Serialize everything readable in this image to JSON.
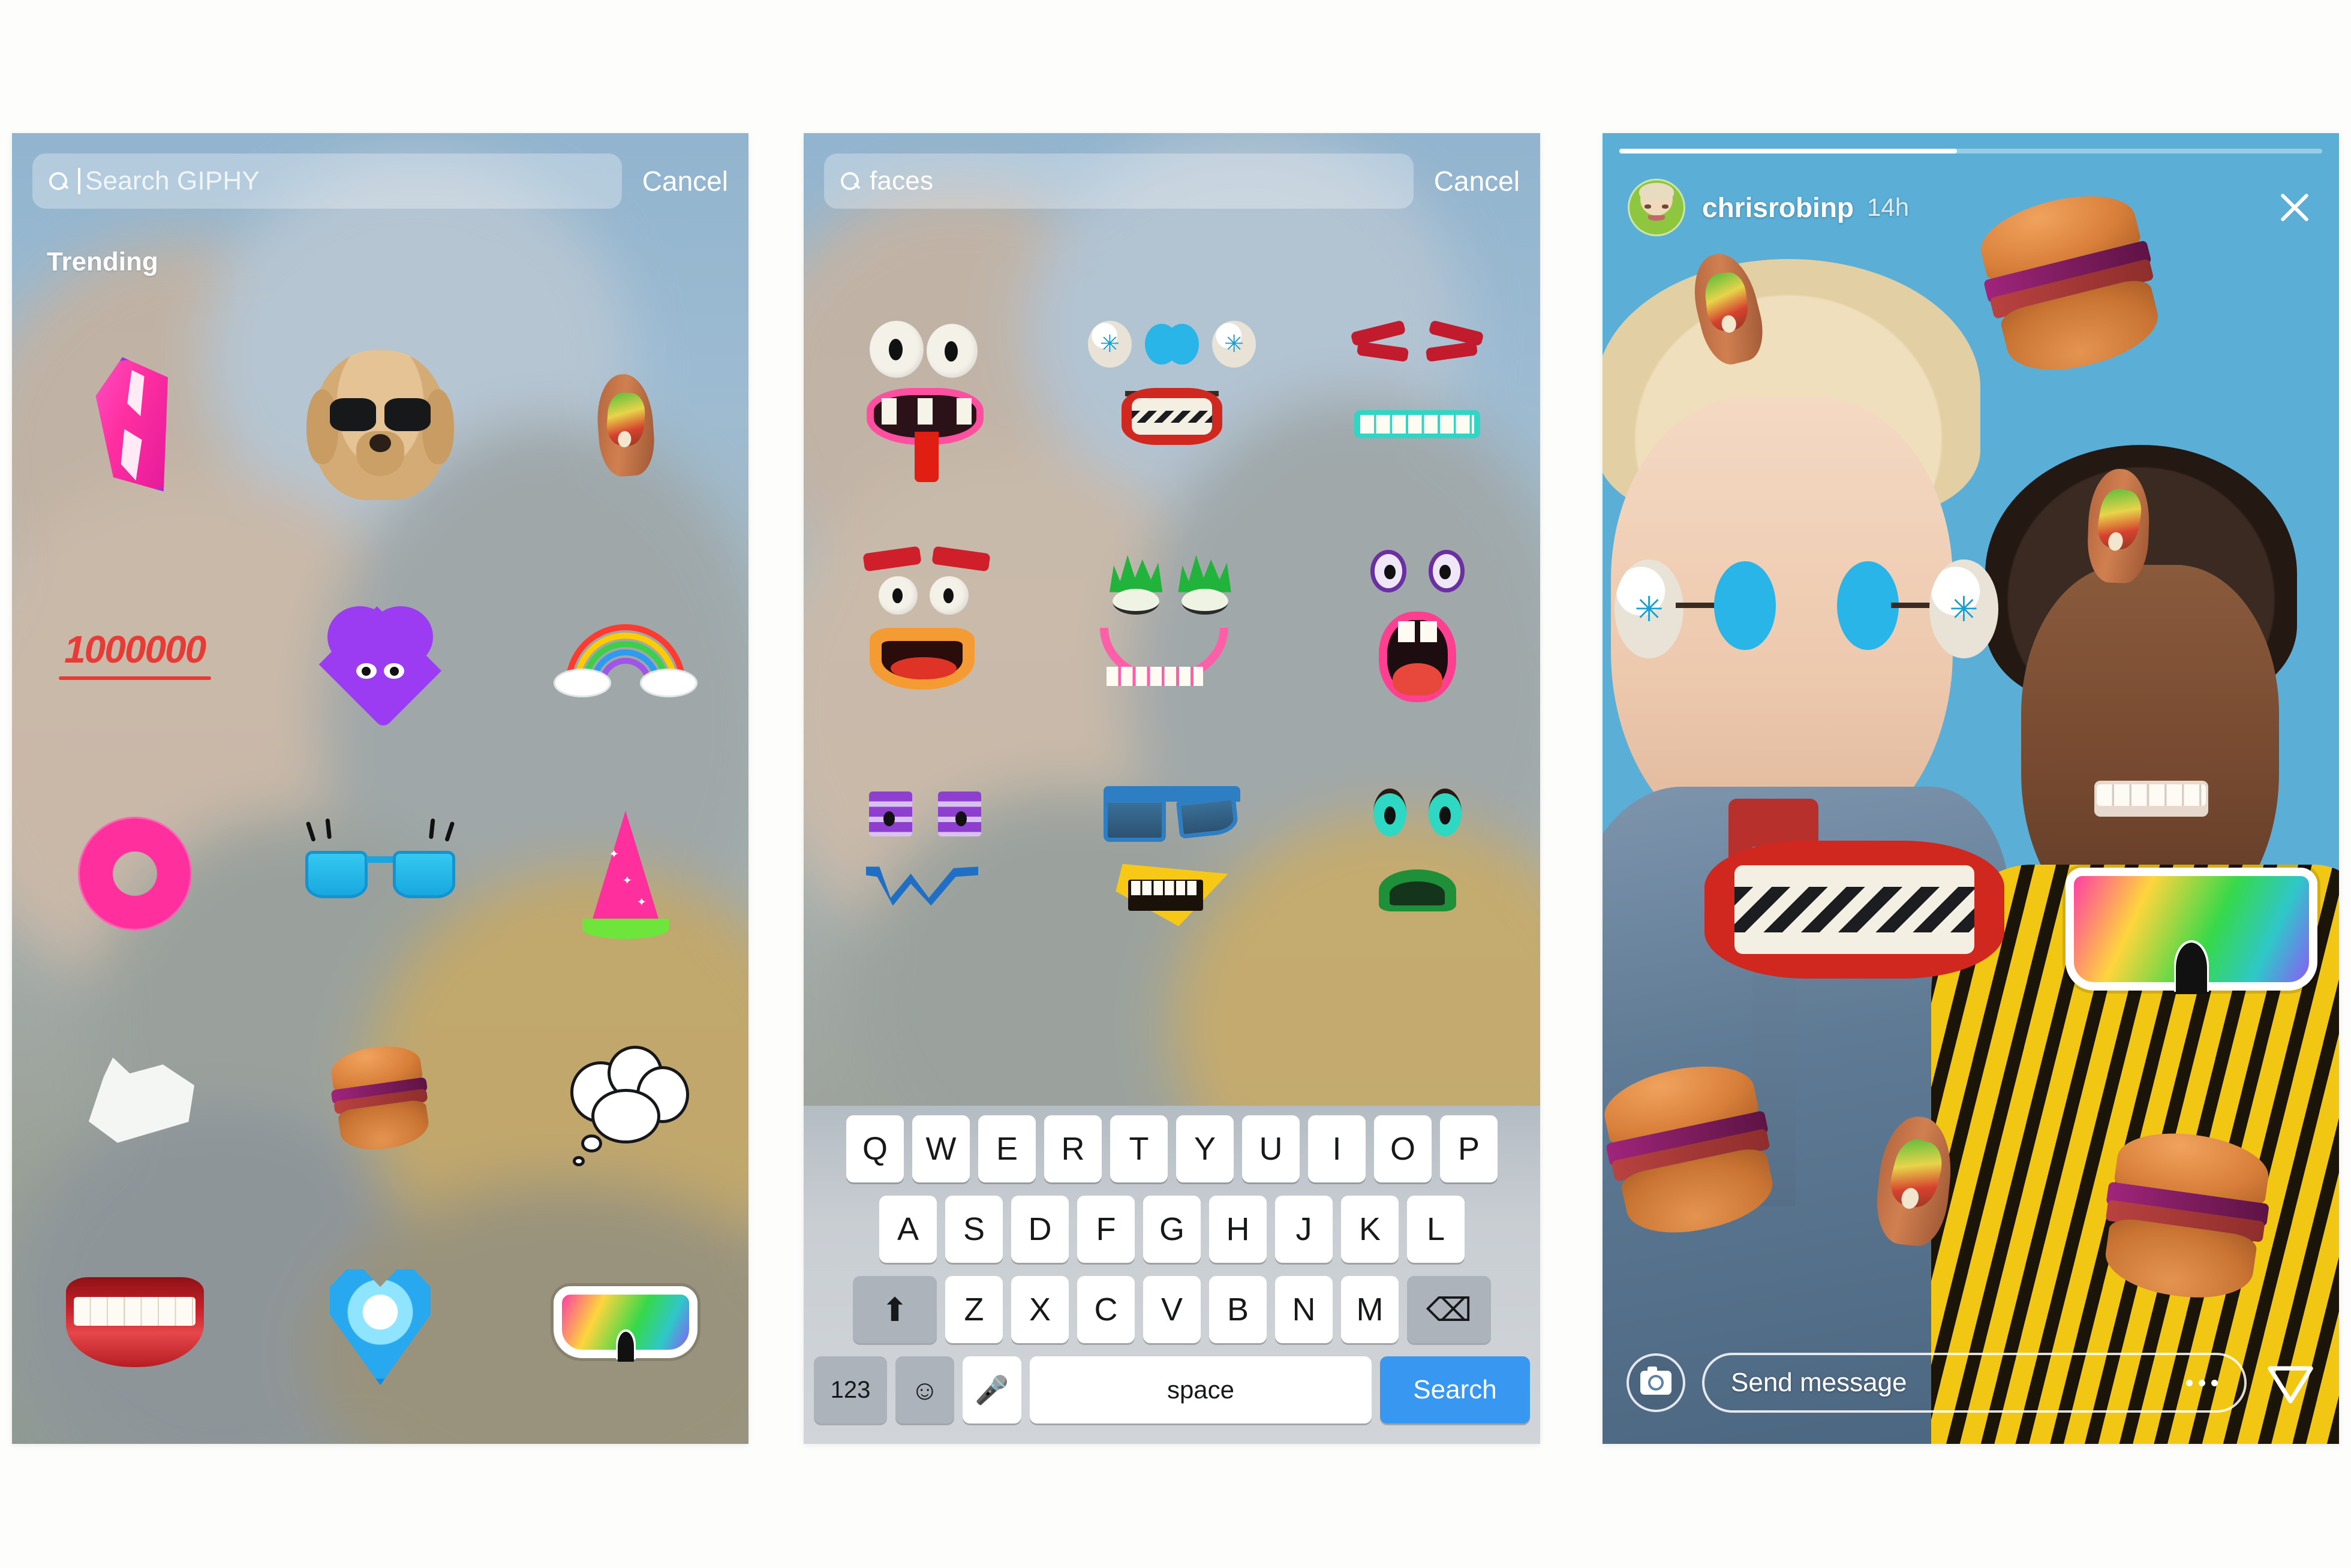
{
  "panels": [
    {
      "id": "giphy-trending",
      "search": {
        "placeholder": "Search GIPHY",
        "value": "",
        "cancel_label": "Cancel",
        "icon": "search-icon"
      },
      "section_title": "Trending",
      "stickers": [
        {
          "name": "pink-gem-sticker",
          "label": "pink gem"
        },
        {
          "name": "dog-sunglasses-sticker",
          "label": "dog with sunglasses"
        },
        {
          "name": "taco-sticker",
          "label": "taco"
        },
        {
          "name": "one-million-text-sticker",
          "label": "1000000"
        },
        {
          "name": "purple-heart-eyes-sticker",
          "label": "purple heart with eyes"
        },
        {
          "name": "rainbow-clouds-sticker",
          "label": "rainbow with clouds"
        },
        {
          "name": "donut-sticker",
          "label": "pink donut"
        },
        {
          "name": "blue-sunglasses-lashes-sticker",
          "label": "blue sunglasses with eyelashes"
        },
        {
          "name": "wizard-hat-sticker",
          "label": "pink wizard hat"
        },
        {
          "name": "horse-head-sticker",
          "label": "white horse head"
        },
        {
          "name": "burger-sticker",
          "label": "burger"
        },
        {
          "name": "thought-bubble-sticker",
          "label": "thought bubble"
        },
        {
          "name": "lips-teeth-sticker",
          "label": "smiling lips with teeth"
        },
        {
          "name": "pixel-heart-sticker",
          "label": "pixel blue heart"
        },
        {
          "name": "rainbow-visor-sticker",
          "label": "rainbow visor sunglasses"
        }
      ]
    },
    {
      "id": "giphy-faces-search",
      "search": {
        "placeholder": "Search GIPHY",
        "value": "faces",
        "cancel_label": "Cancel",
        "icon": "search-icon"
      },
      "stickers": [
        {
          "name": "googly-eyes-pink-mouth-sticker",
          "label": "googly eyes with pink tongue mouth"
        },
        {
          "name": "barbell-eyes-red-teeth-sticker",
          "label": "barbell eyes with red toothy mouth"
        },
        {
          "name": "red-lashes-teal-teeth-sticker",
          "label": "red eyelashes with teal teeth"
        },
        {
          "name": "red-brows-orange-smile-sticker",
          "label": "red eyebrows with orange smile"
        },
        {
          "name": "green-brows-pink-smile-sticker",
          "label": "green spiky brows with pink smile"
        },
        {
          "name": "purple-eyes-pink-scream-sticker",
          "label": "purple eyes with pink open mouth"
        },
        {
          "name": "purple-eyes-blue-squiggle-sticker",
          "label": "purple eyes with blue squiggle mouth"
        },
        {
          "name": "blue-shades-yellow-mouth-sticker",
          "label": "blue sunglasses with yellow mouth"
        },
        {
          "name": "teal-eyes-green-frown-sticker",
          "label": "teal eyes with green frown"
        }
      ],
      "keyboard": {
        "row1": [
          "Q",
          "W",
          "E",
          "R",
          "T",
          "Y",
          "U",
          "I",
          "O",
          "P"
        ],
        "row2": [
          "A",
          "S",
          "D",
          "F",
          "G",
          "H",
          "J",
          "K",
          "L"
        ],
        "row3": [
          "Z",
          "X",
          "C",
          "V",
          "B",
          "N",
          "M"
        ],
        "shift_icon": "shift-arrow-icon",
        "delete_icon": "backspace-icon",
        "numbers_label": "123",
        "emoji_icon": "emoji-smiley-icon",
        "mic_icon": "microphone-icon",
        "space_label": "space",
        "go_label": "Search",
        "go_color": "#3897f0"
      }
    },
    {
      "id": "instagram-story",
      "progress": {
        "segments": 1,
        "filled_percent": 48
      },
      "header": {
        "username": "chrisrobinp",
        "timestamp": "14h",
        "close_icon": "close-x-icon",
        "avatar": "avatar"
      },
      "footer": {
        "camera_icon": "camera-icon",
        "message_placeholder": "Send message",
        "more_icon": "more-dots-icon",
        "send_icon": "send-paper-plane-icon"
      },
      "applied_stickers": [
        {
          "name": "taco-sticker-left-hair",
          "label": "taco"
        },
        {
          "name": "burger-sticker-top-air",
          "label": "burger"
        },
        {
          "name": "taco-sticker-right-hair",
          "label": "taco"
        },
        {
          "name": "barbell-eyes-sticker",
          "label": "barbell eyes"
        },
        {
          "name": "red-toothy-mouth-sticker",
          "label": "red toothy mouth"
        },
        {
          "name": "rainbow-visor-sticker",
          "label": "rainbow visor"
        },
        {
          "name": "burger-sticker-left-hand",
          "label": "burger"
        },
        {
          "name": "taco-sticker-center",
          "label": "taco"
        },
        {
          "name": "burger-sticker-right-hand",
          "label": "burger"
        }
      ]
    }
  ],
  "colors": {
    "story_background": "#5bafd7",
    "keyboard_accent": "#3897f0",
    "panel_gradient_top": "#92b4ce",
    "page_background": "#fdfdfb"
  }
}
